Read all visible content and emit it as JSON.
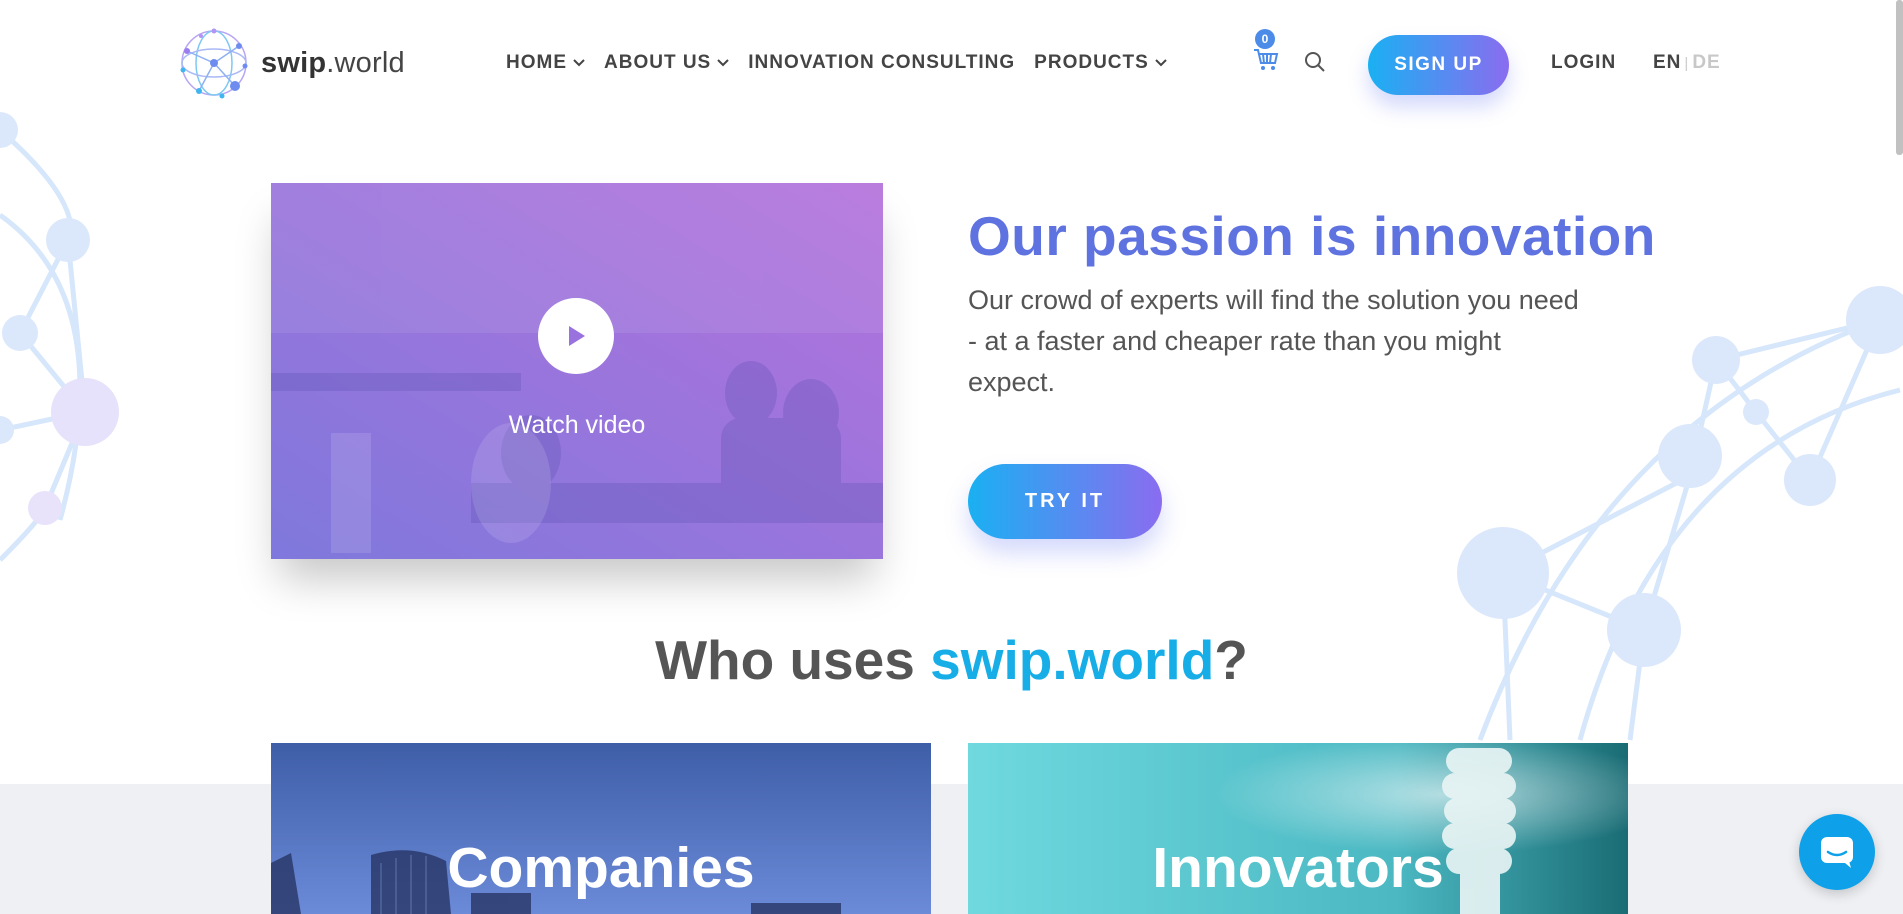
{
  "header": {
    "logo_bold": "swip",
    "logo_rest": ".world",
    "nav": [
      {
        "label": "HOME"
      },
      {
        "label": "ABOUT US"
      },
      {
        "label": "INNOVATION CONSULTING"
      },
      {
        "label": "PRODUCTS"
      }
    ],
    "cart_count": "0",
    "signup_label": "SIGN UP",
    "login_label": "LOGIN",
    "lang_active": "EN",
    "lang_separator": "|",
    "lang_inactive": "DE"
  },
  "hero": {
    "video_label": "Watch video",
    "title": "Our passion is innovation",
    "subtitle": "Our crowd of experts will find the solution you need - at a faster and cheaper rate than you might expect.",
    "cta_label": "TRY IT"
  },
  "who": {
    "prefix": "Who uses ",
    "brand": "swip.world",
    "suffix": "?"
  },
  "cards": [
    {
      "label": "Companies"
    },
    {
      "label": "Innovators"
    }
  ],
  "colors": {
    "accent_blue": "#5e72e0",
    "brand_cyan": "#17aee8",
    "gradient_start": "#1ab0f2",
    "gradient_end": "#8a6cf0"
  },
  "icons": {
    "logo": "network-sphere-icon",
    "cart": "shopping-cart-icon",
    "search": "search-icon",
    "play": "play-icon",
    "chat": "chat-bubble-icon",
    "chevron": "chevron-down-icon"
  }
}
